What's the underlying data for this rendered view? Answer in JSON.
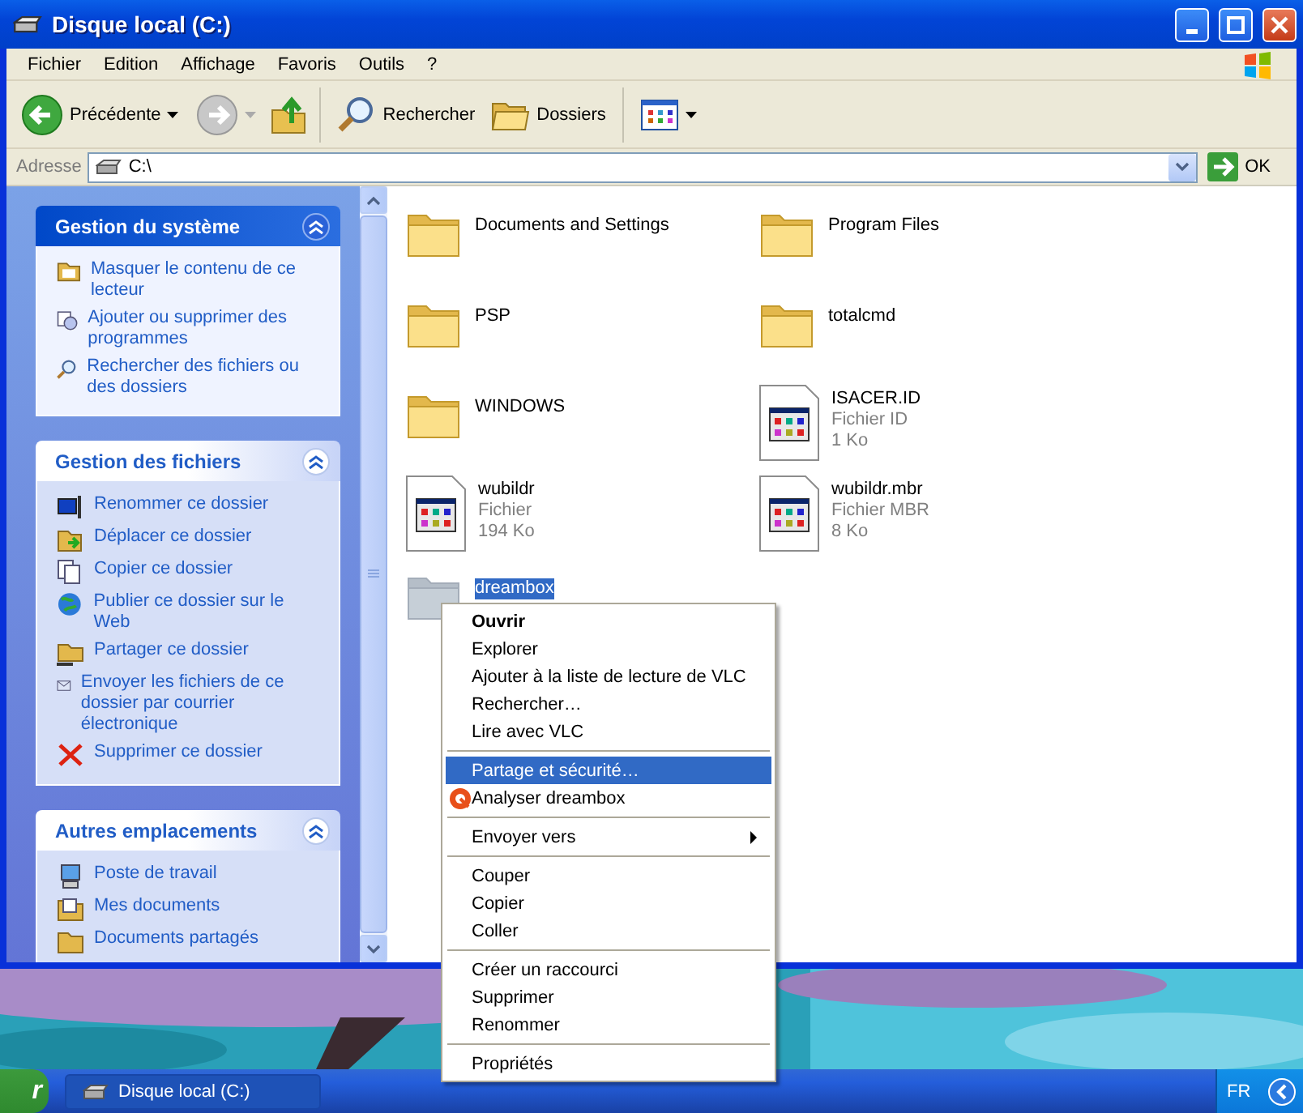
{
  "window": {
    "title": "Disque local (C:)"
  },
  "menu": [
    "Fichier",
    "Edition",
    "Affichage",
    "Favoris",
    "Outils",
    "?"
  ],
  "toolbar": {
    "back": "Précédente",
    "search": "Rechercher",
    "folders": "Dossiers"
  },
  "address": {
    "label": "Adresse",
    "value": "C:\\",
    "go": "OK"
  },
  "task_panels": [
    {
      "title": "Gestion du système",
      "kind": "special",
      "items": [
        {
          "label": "Masquer le contenu de ce lecteur",
          "kind": "hide"
        },
        {
          "label": "Ajouter ou supprimer des programmes",
          "kind": "programs"
        },
        {
          "label": "Rechercher des fichiers ou des dossiers",
          "kind": "search"
        }
      ]
    },
    {
      "title": "Gestion des fichiers",
      "kind": "normal",
      "items": [
        {
          "label": "Renommer ce dossier",
          "kind": "rename"
        },
        {
          "label": "Déplacer ce dossier",
          "kind": "move"
        },
        {
          "label": "Copier ce dossier",
          "kind": "copy"
        },
        {
          "label": "Publier ce dossier sur le Web",
          "kind": "web"
        },
        {
          "label": "Partager ce dossier",
          "kind": "share"
        },
        {
          "label": "Envoyer les fichiers de ce dossier par courrier électronique",
          "kind": "mail"
        },
        {
          "label": "Supprimer ce dossier",
          "kind": "delete"
        }
      ]
    },
    {
      "title": "Autres emplacements",
      "kind": "normal",
      "items": [
        {
          "label": "Poste de travail",
          "kind": "computer"
        },
        {
          "label": "Mes documents",
          "kind": "documents"
        },
        {
          "label": "Documents partagés",
          "kind": "folder"
        }
      ]
    }
  ],
  "files": [
    {
      "name": "Documents and Settings",
      "kind": "folder",
      "selected": false
    },
    {
      "name": "Program Files",
      "kind": "folder",
      "selected": false
    },
    {
      "name": "PSP",
      "kind": "folder",
      "selected": false
    },
    {
      "name": "totalcmd",
      "kind": "folder",
      "selected": false
    },
    {
      "name": "WINDOWS",
      "kind": "folder",
      "selected": false
    },
    {
      "name": "ISACER.ID",
      "kind": "file",
      "type": "Fichier ID",
      "size": "1 Ko",
      "selected": false
    },
    {
      "name": "wubildr",
      "kind": "file",
      "type": "Fichier",
      "size": "194 Ko",
      "selected": false
    },
    {
      "name": "wubildr.mbr",
      "kind": "file",
      "type": "Fichier MBR",
      "size": "8 Ko",
      "selected": false
    },
    {
      "name": "dreambox",
      "kind": "folder",
      "selected": true
    }
  ],
  "context_menu": [
    [
      {
        "label": "Ouvrir",
        "kind": "text",
        "default": true,
        "selected": false
      },
      {
        "label": "Explorer",
        "kind": "text",
        "default": false,
        "selected": false
      },
      {
        "label": "Ajouter à la liste de lecture de VLC",
        "kind": "text",
        "default": false,
        "selected": false
      },
      {
        "label": "Rechercher…",
        "kind": "text",
        "default": false,
        "selected": false
      },
      {
        "label": "Lire avec VLC",
        "kind": "text",
        "default": false,
        "selected": false
      }
    ],
    [
      {
        "label": "Partage et sécurité…",
        "kind": "text",
        "default": false,
        "selected": true
      },
      {
        "label": "Analyser dreambox",
        "kind": "icon",
        "default": false,
        "selected": false
      }
    ],
    [
      {
        "label": "Envoyer vers",
        "kind": "submenu",
        "default": false,
        "selected": false
      }
    ],
    [
      {
        "label": "Couper",
        "kind": "text",
        "default": false,
        "selected": false
      },
      {
        "label": "Copier",
        "kind": "text",
        "default": false,
        "selected": false
      },
      {
        "label": "Coller",
        "kind": "text",
        "default": false,
        "selected": false
      }
    ],
    [
      {
        "label": "Créer un raccourci",
        "kind": "text",
        "default": false,
        "selected": false
      },
      {
        "label": "Supprimer",
        "kind": "text",
        "default": false,
        "selected": false
      },
      {
        "label": "Renommer",
        "kind": "text",
        "default": false,
        "selected": false
      }
    ],
    [
      {
        "label": "Propriétés",
        "kind": "text",
        "default": false,
        "selected": false
      }
    ]
  ],
  "taskbar": {
    "start": "r",
    "task": "Disque local (C:)",
    "language": "FR"
  }
}
